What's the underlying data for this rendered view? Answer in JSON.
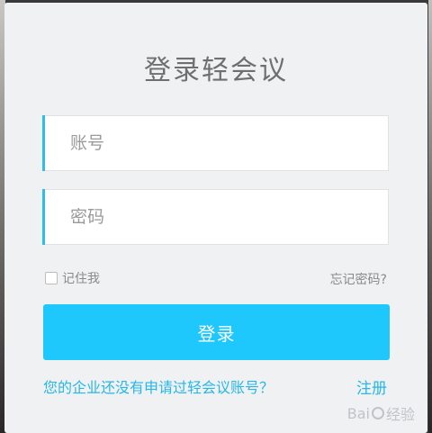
{
  "title": "登录轻会议",
  "account": {
    "placeholder": "账号"
  },
  "password": {
    "placeholder": "密码"
  },
  "remember": {
    "label": "记住我"
  },
  "forgot": {
    "label": "忘记密码?"
  },
  "login": {
    "label": "登录"
  },
  "footer": {
    "no_account": "您的企业还没有申请过轻会议账号？",
    "register": "注册"
  },
  "watermark": {
    "prefix": "Bai",
    "suffix": "经验"
  },
  "colors": {
    "accent": "#1fc8fc",
    "link": "#27b7e8",
    "card": "#eff1f3"
  },
  "icons": {
    "remember": "checkbox-icon",
    "watermark": "paw-icon"
  }
}
